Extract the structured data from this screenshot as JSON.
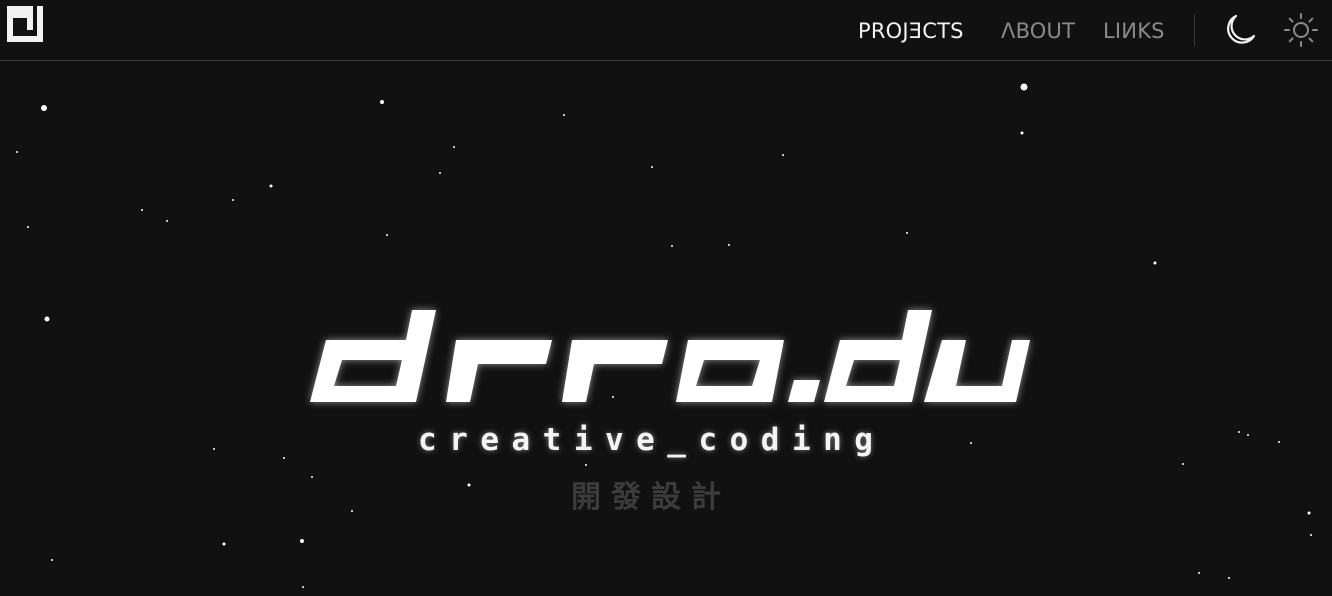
{
  "nav": {
    "items": [
      {
        "label": "PROJƎCTS",
        "active": true
      },
      {
        "label": "ΛBOUT",
        "active": false
      },
      {
        "label": "LIИKS",
        "active": false
      }
    ]
  },
  "theme": {
    "dark_icon": "moon-icon",
    "light_icon": "sun-icon"
  },
  "hero": {
    "title": "drro.du",
    "subtitle": "creative_coding",
    "tagline": "開發設計"
  },
  "colors": {
    "background": "#111111",
    "text": "#f2f2f2",
    "muted": "#8a8a8a"
  }
}
